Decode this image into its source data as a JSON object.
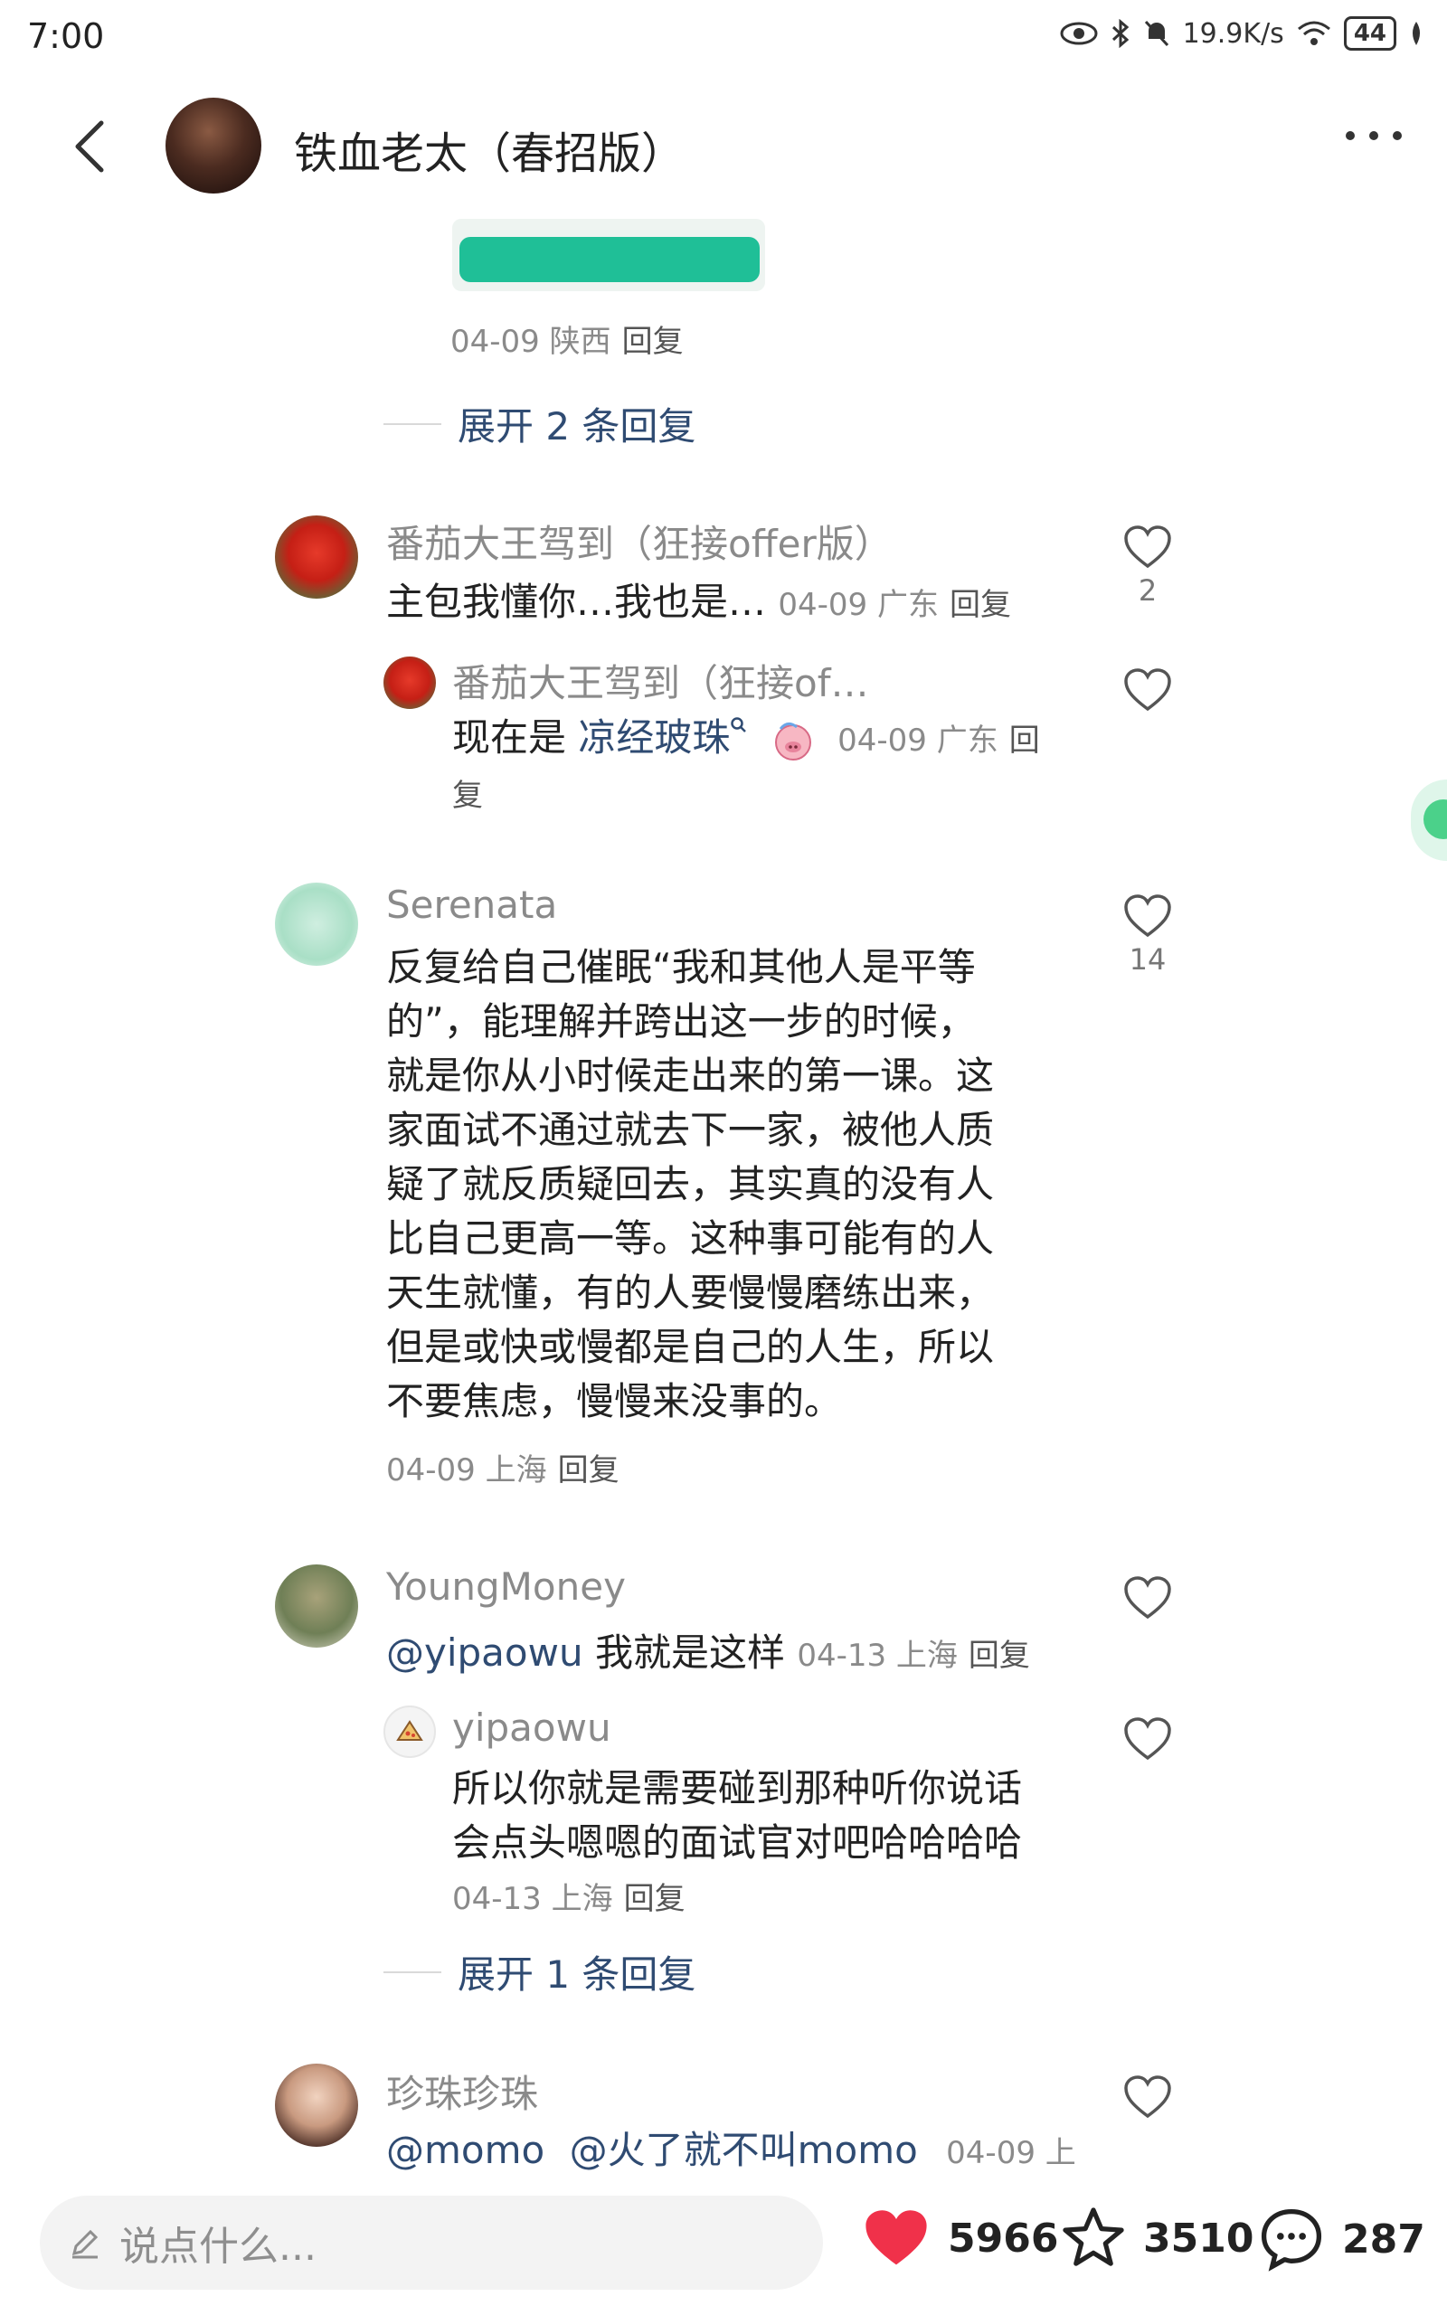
{
  "status_bar": {
    "time": "7:00",
    "net_speed": "19.9K/s",
    "battery": "44"
  },
  "header": {
    "title": "铁血老太（春招版）"
  },
  "top_comment": {
    "meta_date_region": "04-09 陕西",
    "reply": "回复",
    "expand": "展开 2 条回复"
  },
  "comments": [
    {
      "name": "番茄大王驾到（狂接offer版）",
      "text": "主包我懂你…我也是…",
      "date_region": "04-09 广东",
      "reply": "回复",
      "likes": "2",
      "sub": {
        "name": "番茄大王驾到（狂接of…",
        "text_prefix": "现在是 ",
        "link": "凉经玻珠",
        "date_region": "04-09 广东",
        "reply_part1": "回",
        "reply_part2": "复"
      }
    },
    {
      "name": "Serenata",
      "lines": [
        "反复给自己催眠“我和其他人是平等",
        "的”，能理解并跨出这一步的时候，",
        "就是你从小时候走出来的第一课。这",
        "家面试不通过就去下一家，被他人质",
        "疑了就反质疑回去，其实真的没有人",
        "比自己更高一等。这种事可能有的人",
        "天生就懂，有的人要慢慢磨练出来，",
        "但是或快或慢都是自己的人生，所以",
        "不要焦虑，慢慢来没事的。"
      ],
      "date_region": "04-09 上海",
      "reply": "回复",
      "likes": "14"
    },
    {
      "name": "YoungMoney",
      "mention": "@yipaowu",
      "text": " 我就是这样",
      "date_region": "04-13 上海",
      "reply": "回复",
      "sub": {
        "name": "yipaowu",
        "lines": [
          "所以你就是需要碰到那种听你说话",
          "会点头嗯嗯的面试官对吧哈哈哈哈"
        ],
        "date_region": "04-13 上海",
        "reply": "回复"
      },
      "expand": "展开 1 条回复"
    },
    {
      "name": "珍珠珍珠",
      "mention1": "@momo",
      "mention2": "@火了就不叫momo",
      "date_region": "04-09 上"
    }
  ],
  "bottom_bar": {
    "placeholder": "说点什么...",
    "like_count": "5966",
    "star_count": "3510",
    "comment_count": "287"
  },
  "colors": {
    "accent_red": "#f0314a",
    "link_blue": "#2f4b72",
    "green": "#1fbf97"
  }
}
